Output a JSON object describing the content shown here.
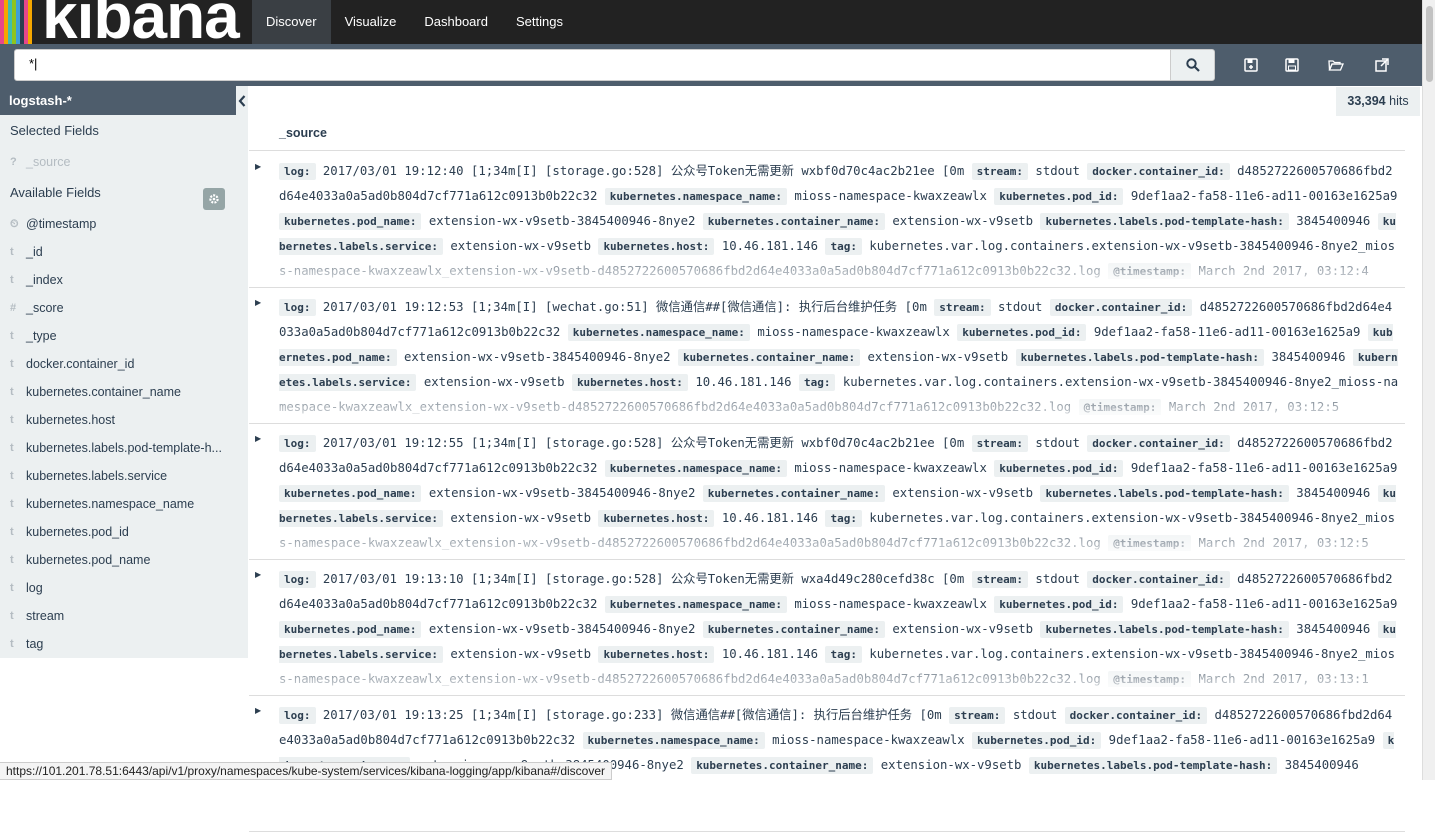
{
  "brand": {
    "name": "kibana",
    "stripe_colors": [
      "#e8478b",
      "#f5a700",
      "#3ebeb0",
      "#8fc41e",
      "#3f9fd8",
      "#2c3e50",
      "#e8478b",
      "#f5a700"
    ]
  },
  "nav": {
    "tabs": [
      {
        "label": "Discover",
        "active": true
      },
      {
        "label": "Visualize"
      },
      {
        "label": "Dashboard"
      },
      {
        "label": "Settings"
      }
    ]
  },
  "search": {
    "query": "*|"
  },
  "toolbar": {
    "icons": [
      "new-search-icon",
      "save-search-icon",
      "open-search-icon",
      "share-icon"
    ]
  },
  "sidebar": {
    "index_pattern": "logstash-*",
    "selected_title": "Selected Fields",
    "source_field": {
      "type": "?",
      "name": "_source"
    },
    "available_title": "Available Fields",
    "fields": [
      {
        "type": "⏲",
        "name": "@timestamp"
      },
      {
        "type": "t",
        "name": "_id"
      },
      {
        "type": "t",
        "name": "_index"
      },
      {
        "type": "#",
        "name": "_score"
      },
      {
        "type": "t",
        "name": "_type"
      },
      {
        "type": "t",
        "name": "docker.container_id"
      },
      {
        "type": "t",
        "name": "kubernetes.container_name"
      },
      {
        "type": "t",
        "name": "kubernetes.host"
      },
      {
        "type": "t",
        "name": "kubernetes.labels.pod-template-h..."
      },
      {
        "type": "t",
        "name": "kubernetes.labels.service"
      },
      {
        "type": "t",
        "name": "kubernetes.namespace_name"
      },
      {
        "type": "t",
        "name": "kubernetes.pod_id"
      },
      {
        "type": "t",
        "name": "kubernetes.pod_name"
      },
      {
        "type": "t",
        "name": "log"
      },
      {
        "type": "t",
        "name": "stream"
      },
      {
        "type": "t",
        "name": "tag"
      }
    ]
  },
  "results": {
    "hits_count": "33,394",
    "hits_label": "hits",
    "column": "_source",
    "docs": [
      {
        "entries": [
          {
            "k": "log:",
            "v": "2017/03/01 19:12:40 [1;34m[I] [storage.go:528] 公众号Token无需更新 wxbf0d70c4ac2b21ee [0m"
          },
          {
            "k": "stream:",
            "v": "stdout"
          },
          {
            "k": "docker.container_id:",
            "v": "d4852722600570686fbd2d64e4033a0a5ad0b804d7cf771a612c0913b0b22c32"
          },
          {
            "k": "kubernetes.namespace_name:",
            "v": "mioss-namespace-kwaxzeawlx"
          },
          {
            "k": "kubernetes.pod_id:",
            "v": "9def1aa2-fa58-11e6-ad11-00163e1625a9"
          },
          {
            "k": "kubernetes.pod_name:",
            "v": "extension-wx-v9setb-3845400946-8nye2"
          },
          {
            "k": "kubernetes.container_name:",
            "v": "extension-wx-v9setb"
          },
          {
            "k": "kubernetes.labels.pod-template-hash:",
            "v": "3845400946"
          },
          {
            "k": "kubernetes.labels.service:",
            "v": "extension-wx-v9setb"
          },
          {
            "k": "kubernetes.host:",
            "v": "10.46.181.146"
          },
          {
            "k": "tag:",
            "v": "kubernetes.var.log.containers.extension-wx-v9setb-3845400946-8nye2_mioss-namespace-kwaxzeawlx_extension-wx-v9setb-d4852722600570686fbd2d64e4033a0a5ad0b804d7cf771a612c0913b0b22c32.log"
          },
          {
            "k": "@timestamp:",
            "v": "March 2nd 2017, 03:12:4"
          }
        ]
      },
      {
        "entries": [
          {
            "k": "log:",
            "v": "2017/03/01 19:12:53 [1;34m[I] [wechat.go:51] 微信通信##[微信通信]: 执行后台维护任务 [0m"
          },
          {
            "k": "stream:",
            "v": "stdout"
          },
          {
            "k": "docker.container_id:",
            "v": "d4852722600570686fbd2d64e4033a0a5ad0b804d7cf771a612c0913b0b22c32"
          },
          {
            "k": "kubernetes.namespace_name:",
            "v": "mioss-namespace-kwaxzeawlx"
          },
          {
            "k": "kubernetes.pod_id:",
            "v": "9def1aa2-fa58-11e6-ad11-00163e1625a9"
          },
          {
            "k": "kubernetes.pod_name:",
            "v": "extension-wx-v9setb-3845400946-8nye2"
          },
          {
            "k": "kubernetes.container_name:",
            "v": "extension-wx-v9setb"
          },
          {
            "k": "kubernetes.labels.pod-template-hash:",
            "v": "3845400946"
          },
          {
            "k": "kubernetes.labels.service:",
            "v": "extension-wx-v9setb"
          },
          {
            "k": "kubernetes.host:",
            "v": "10.46.181.146"
          },
          {
            "k": "tag:",
            "v": "kubernetes.var.log.containers.extension-wx-v9setb-3845400946-8nye2_mioss-namespace-kwaxzeawlx_extension-wx-v9setb-d4852722600570686fbd2d64e4033a0a5ad0b804d7cf771a612c0913b0b22c32.log"
          },
          {
            "k": "@timestamp:",
            "v": "March 2nd 2017, 03:12:5"
          }
        ]
      },
      {
        "entries": [
          {
            "k": "log:",
            "v": "2017/03/01 19:12:55 [1;34m[I] [storage.go:528] 公众号Token无需更新 wxbf0d70c4ac2b21ee [0m"
          },
          {
            "k": "stream:",
            "v": "stdout"
          },
          {
            "k": "docker.container_id:",
            "v": "d4852722600570686fbd2d64e4033a0a5ad0b804d7cf771a612c0913b0b22c32"
          },
          {
            "k": "kubernetes.namespace_name:",
            "v": "mioss-namespace-kwaxzeawlx"
          },
          {
            "k": "kubernetes.pod_id:",
            "v": "9def1aa2-fa58-11e6-ad11-00163e1625a9"
          },
          {
            "k": "kubernetes.pod_name:",
            "v": "extension-wx-v9setb-3845400946-8nye2"
          },
          {
            "k": "kubernetes.container_name:",
            "v": "extension-wx-v9setb"
          },
          {
            "k": "kubernetes.labels.pod-template-hash:",
            "v": "3845400946"
          },
          {
            "k": "kubernetes.labels.service:",
            "v": "extension-wx-v9setb"
          },
          {
            "k": "kubernetes.host:",
            "v": "10.46.181.146"
          },
          {
            "k": "tag:",
            "v": "kubernetes.var.log.containers.extension-wx-v9setb-3845400946-8nye2_mioss-namespace-kwaxzeawlx_extension-wx-v9setb-d4852722600570686fbd2d64e4033a0a5ad0b804d7cf771a612c0913b0b22c32.log"
          },
          {
            "k": "@timestamp:",
            "v": "March 2nd 2017, 03:12:5"
          }
        ]
      },
      {
        "entries": [
          {
            "k": "log:",
            "v": "2017/03/01 19:13:10 [1;34m[I] [storage.go:528] 公众号Token无需更新 wxa4d49c280cefd38c [0m"
          },
          {
            "k": "stream:",
            "v": "stdout"
          },
          {
            "k": "docker.container_id:",
            "v": "d4852722600570686fbd2d64e4033a0a5ad0b804d7cf771a612c0913b0b22c32"
          },
          {
            "k": "kubernetes.namespace_name:",
            "v": "mioss-namespace-kwaxzeawlx"
          },
          {
            "k": "kubernetes.pod_id:",
            "v": "9def1aa2-fa58-11e6-ad11-00163e1625a9"
          },
          {
            "k": "kubernetes.pod_name:",
            "v": "extension-wx-v9setb-3845400946-8nye2"
          },
          {
            "k": "kubernetes.container_name:",
            "v": "extension-wx-v9setb"
          },
          {
            "k": "kubernetes.labels.pod-template-hash:",
            "v": "3845400946"
          },
          {
            "k": "kubernetes.labels.service:",
            "v": "extension-wx-v9setb"
          },
          {
            "k": "kubernetes.host:",
            "v": "10.46.181.146"
          },
          {
            "k": "tag:",
            "v": "kubernetes.var.log.containers.extension-wx-v9setb-3845400946-8nye2_mioss-namespace-kwaxzeawlx_extension-wx-v9setb-d4852722600570686fbd2d64e4033a0a5ad0b804d7cf771a612c0913b0b22c32.log"
          },
          {
            "k": "@timestamp:",
            "v": "March 2nd 2017, 03:13:1"
          }
        ]
      },
      {
        "entries": [
          {
            "k": "log:",
            "v": "2017/03/01 19:13:25 [1;34m[I] [storage.go:233] 微信通信##[微信通信]: 执行后台维护任务 [0m"
          },
          {
            "k": "stream:",
            "v": "stdout"
          },
          {
            "k": "docker.container_id:",
            "v": "d4852722600570686fbd2d64e4033a0a5ad0b804d7cf771a612c0913b0b22c32"
          },
          {
            "k": "kubernetes.namespace_name:",
            "v": "mioss-namespace-kwaxzeawlx"
          },
          {
            "k": "kubernetes.pod_id:",
            "v": "9def1aa2-fa58-11e6-ad11-00163e1625a9"
          },
          {
            "k": "kubernetes.pod_name:",
            "v": "extension-wx-v9setb-3845400946-8nye2"
          },
          {
            "k": "kubernetes.container_name:",
            "v": "extension-wx-v9setb"
          },
          {
            "k": "kubernetes.labels.pod-template-hash:",
            "v": "3845400946"
          }
        ]
      }
    ]
  },
  "status_url": "https://101.201.78.51:6443/api/v1/proxy/namespaces/kube-system/services/kibana-logging/app/kibana#/discover"
}
